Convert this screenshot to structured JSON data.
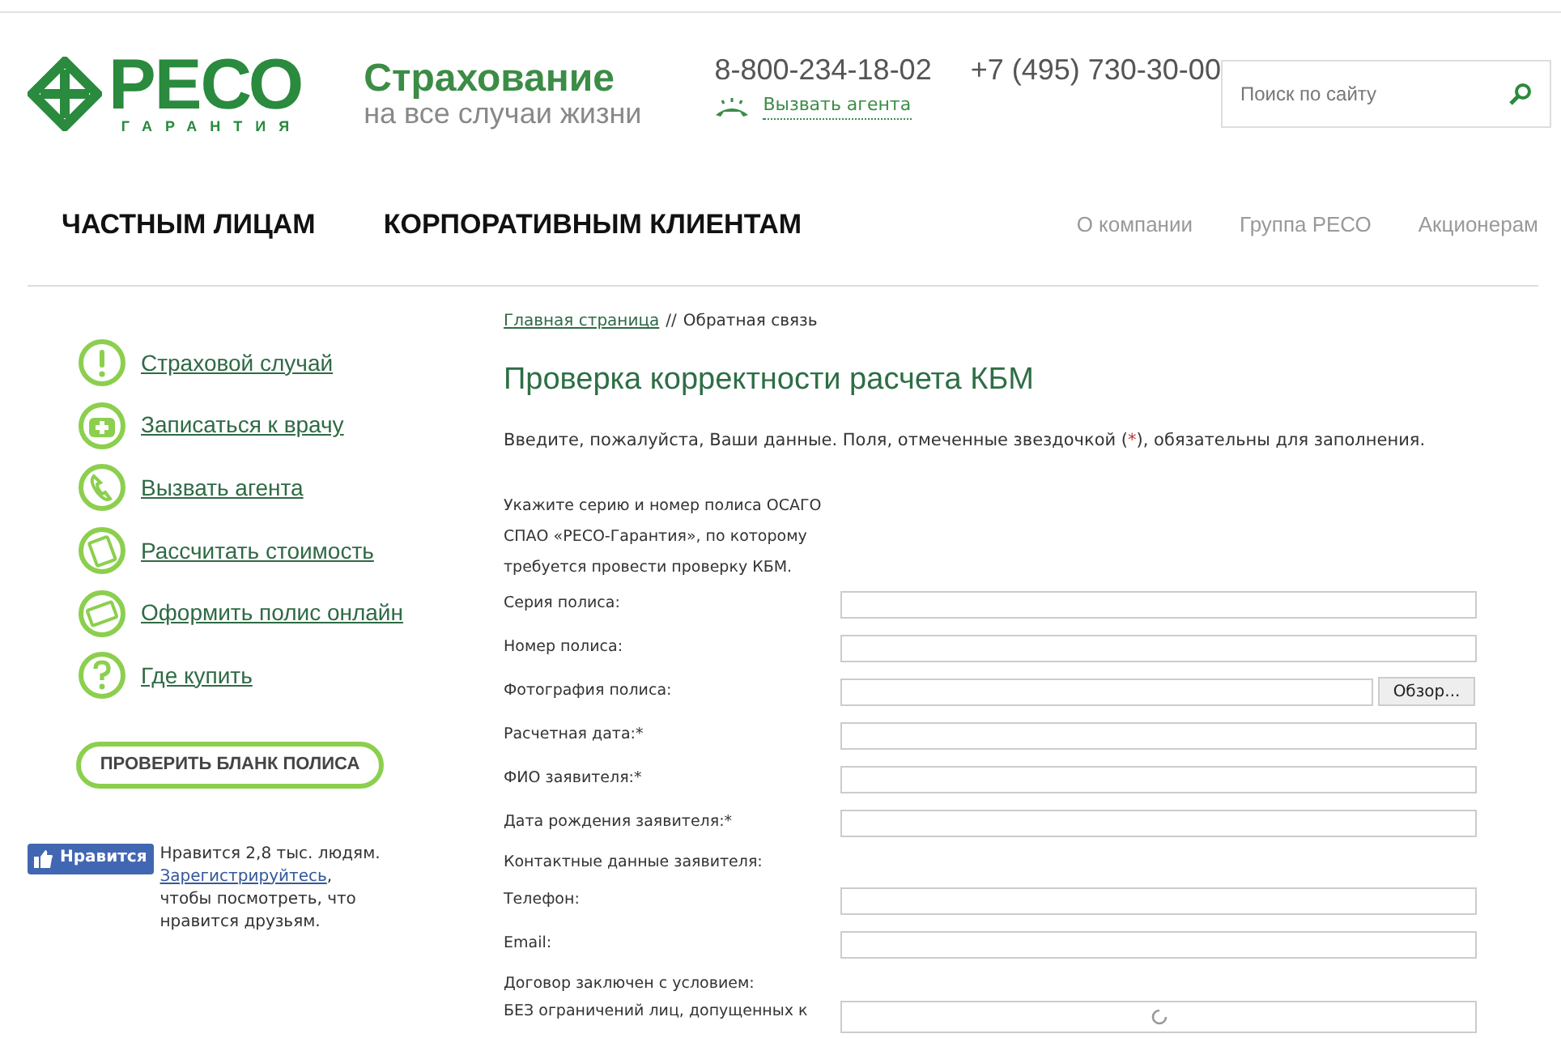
{
  "logo": {
    "name": "РЕСО",
    "subtitle": "ГАРАНТИЯ"
  },
  "tagline": {
    "title": "Страхование",
    "subtitle": "на все случаи жизни"
  },
  "phones": [
    "8-800-234-18-02",
    "+7 (495) 730-30-00"
  ],
  "call_agent_link": "Вызвать агента",
  "search": {
    "placeholder": "Поиск по сайту"
  },
  "main_nav": [
    "ЧАСТНЫМ ЛИЦАМ",
    "КОРПОРАТИВНЫМ КЛИЕНТАМ"
  ],
  "secondary_nav": [
    "О компании",
    "Группа РЕСО",
    "Акционерам"
  ],
  "sidebar": {
    "items": [
      {
        "label": "Страховой случай",
        "kind": "alert"
      },
      {
        "label": "Записаться к врачу",
        "kind": "medical"
      },
      {
        "label": "Вызвать агента",
        "kind": "phone"
      },
      {
        "label": "Рассчитать стоимость",
        "kind": "calculator"
      },
      {
        "label": "Оформить полис онлайн",
        "kind": "card"
      },
      {
        "label": "Где купить",
        "kind": "question"
      }
    ],
    "check_button": "ПРОВЕРИТЬ БЛАНК ПОЛИСА",
    "like": {
      "button": "Нравится",
      "count": "Нравится 2,8 тыс. людям.",
      "register_link": "Зарегистрируйтесь",
      "rest": ", чтобы посмотреть, что нравится друзьям."
    }
  },
  "breadcrumb": {
    "home": "Главная страница",
    "separator": "//",
    "current": "Обратная связь"
  },
  "title": "Проверка корректности расчета КБМ",
  "intro": {
    "before": "Введите, пожалуйста, Ваши данные. Поля, отмеченные звездочкой (",
    "mark": "*",
    "after": "), обязательны для заполнения."
  },
  "form": [
    {
      "kind": "note",
      "label": "Укажите серию и номер полиса ОСАГО СПАО «РЕСО-Гарантия», по которому требуется провести проверку КБМ."
    },
    {
      "kind": "text",
      "label": "Серия полиса:"
    },
    {
      "kind": "text",
      "label": "Номер полиса:"
    },
    {
      "kind": "file",
      "label": "Фотография полиса:",
      "button": "Обзор..."
    },
    {
      "kind": "text",
      "label": "Расчетная дата:*"
    },
    {
      "kind": "text",
      "label": "ФИО заявителя:*"
    },
    {
      "kind": "text",
      "label": "Дата рождения заявителя:*"
    },
    {
      "kind": "heading",
      "label": "Контактные данные заявителя:"
    },
    {
      "kind": "text",
      "label": "Телефон:"
    },
    {
      "kind": "text",
      "label": "Email:"
    },
    {
      "kind": "heading",
      "label": "Договор заключен с условием:"
    },
    {
      "kind": "loading",
      "label": "БЕЗ ограничений лиц, допущенных к"
    }
  ]
}
